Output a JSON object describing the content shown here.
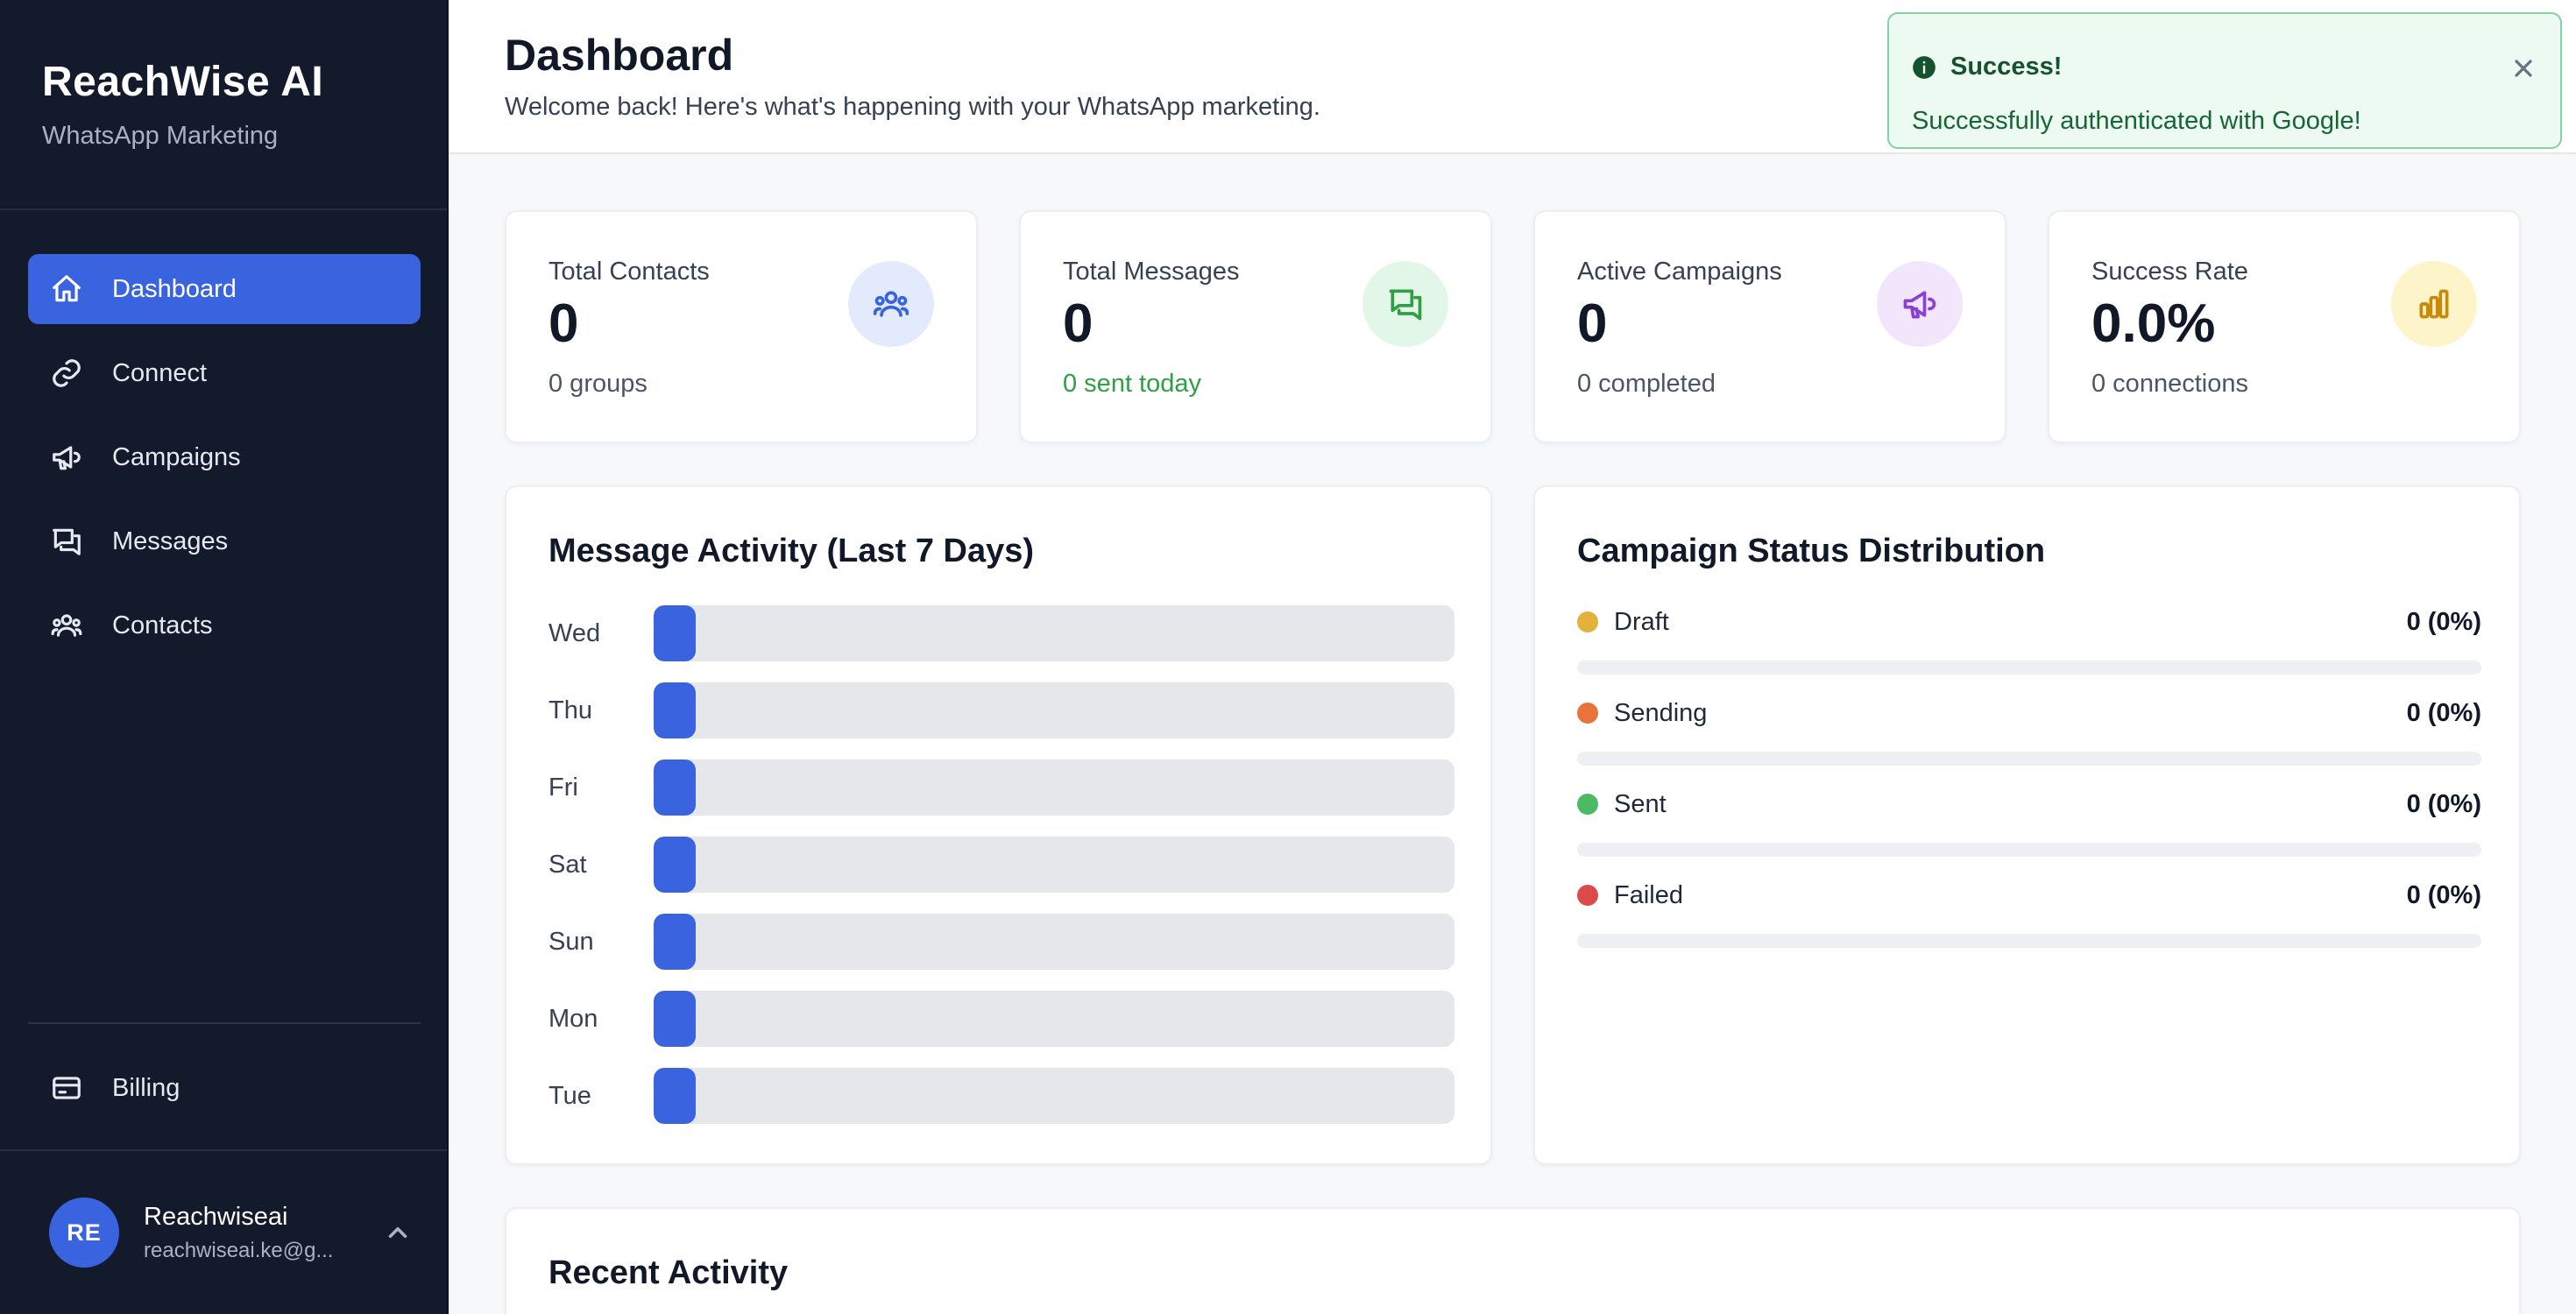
{
  "sidebar": {
    "brand_title": "ReachWise AI",
    "brand_subtitle": "WhatsApp Marketing",
    "nav": [
      {
        "label": "Dashboard",
        "icon": "home-icon",
        "active": true
      },
      {
        "label": "Connect",
        "icon": "link-icon",
        "active": false
      },
      {
        "label": "Campaigns",
        "icon": "megaphone-icon",
        "active": false
      },
      {
        "label": "Messages",
        "icon": "messages-icon",
        "active": false
      },
      {
        "label": "Contacts",
        "icon": "users-icon",
        "active": false
      }
    ],
    "billing_label": "Billing",
    "user": {
      "initials": "RE",
      "name": "Reachwiseai",
      "email": "reachwiseai.ke@g..."
    }
  },
  "header": {
    "title": "Dashboard",
    "subtitle": "Welcome back! Here's what's happening with your WhatsApp marketing."
  },
  "toast": {
    "title": "Success!",
    "message": "Successfully authenticated with Google!"
  },
  "stats": [
    {
      "label": "Total Contacts",
      "value": "0",
      "sub": "0 groups",
      "icon": "users-icon",
      "accent": "#3a63e0",
      "icon_bg": "#e3eafb"
    },
    {
      "label": "Total Messages",
      "value": "0",
      "sub": "0 sent today",
      "icon": "messages-icon",
      "accent": "#2f9e44",
      "icon_bg": "#e3f7e8"
    },
    {
      "label": "Active Campaigns",
      "value": "0",
      "sub": "0 completed",
      "icon": "megaphone-icon",
      "accent": "#8b3fd9",
      "icon_bg": "#f1e6fb"
    },
    {
      "label": "Success Rate",
      "value": "0.0%",
      "sub": "0 connections",
      "icon": "bar-chart-icon",
      "accent": "#c98a0a",
      "icon_bg": "#fdf5c9"
    }
  ],
  "activity": {
    "title": "Message Activity (Last 7 Days)",
    "days": [
      {
        "day": "Wed",
        "count": 0
      },
      {
        "day": "Thu",
        "count": 0
      },
      {
        "day": "Fri",
        "count": 0
      },
      {
        "day": "Sat",
        "count": 0
      },
      {
        "day": "Sun",
        "count": 0
      },
      {
        "day": "Mon",
        "count": 0
      },
      {
        "day": "Tue",
        "count": 0
      }
    ]
  },
  "status": {
    "title": "Campaign Status Distribution",
    "items": [
      {
        "name": "Draft",
        "value": "0 (0%)",
        "color": "#e3b23c"
      },
      {
        "name": "Sending",
        "value": "0 (0%)",
        "color": "#e8743b"
      },
      {
        "name": "Sent",
        "value": "0 (0%)",
        "color": "#4cb963"
      },
      {
        "name": "Failed",
        "value": "0 (0%)",
        "color": "#dc4a4a"
      }
    ]
  },
  "recent": {
    "title": "Recent Activity"
  }
}
